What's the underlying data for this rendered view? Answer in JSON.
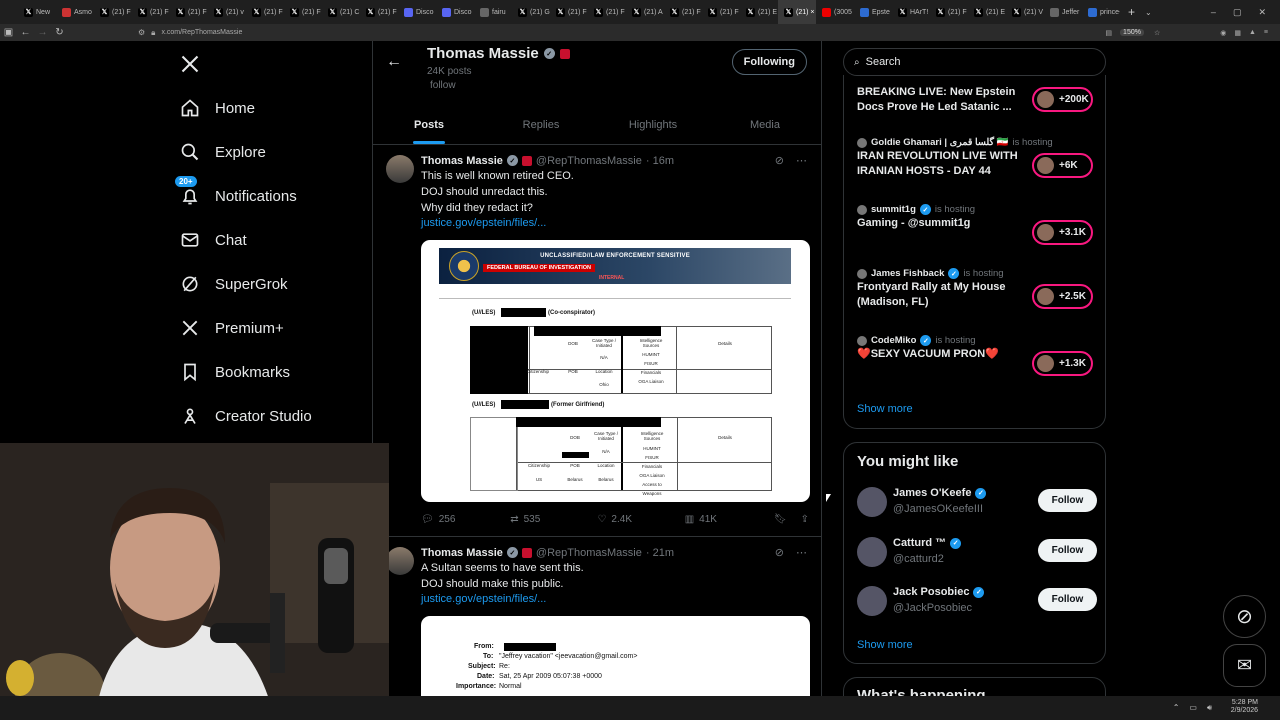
{
  "browser": {
    "tabs": [
      {
        "label": "New",
        "icon": "x-icon"
      },
      {
        "label": "Asmo",
        "icon": "asmon-icon"
      },
      {
        "label": "(21) F",
        "icon": "x-icon"
      },
      {
        "label": "(21) F",
        "icon": "x-icon"
      },
      {
        "label": "(21) F",
        "icon": "x-icon"
      },
      {
        "label": "(21) v",
        "icon": "x-icon"
      },
      {
        "label": "(21) F",
        "icon": "x-icon"
      },
      {
        "label": "(21) F",
        "icon": "x-icon"
      },
      {
        "label": "(21) C",
        "icon": "x-icon"
      },
      {
        "label": "(21) F",
        "icon": "x-icon"
      },
      {
        "label": "Disco",
        "icon": "discord-icon"
      },
      {
        "label": "Disco",
        "icon": "discord-icon"
      },
      {
        "label": "fairu",
        "icon": "globe-icon"
      },
      {
        "label": "(21) G",
        "icon": "x-icon"
      },
      {
        "label": "(21) F",
        "icon": "x-icon"
      },
      {
        "label": "(21) F",
        "icon": "x-icon"
      },
      {
        "label": "(21) A",
        "icon": "x-icon"
      },
      {
        "label": "(21) F",
        "icon": "x-icon"
      },
      {
        "label": "(21) F",
        "icon": "x-icon"
      },
      {
        "label": "(21) E",
        "icon": "x-icon"
      },
      {
        "label": "(21) ×",
        "icon": "x-icon",
        "active": true
      },
      {
        "label": "(3005",
        "icon": "youtube-icon"
      },
      {
        "label": "Epste",
        "icon": "doc-icon"
      },
      {
        "label": "HArT!",
        "icon": "x-icon"
      },
      {
        "label": "(21) F",
        "icon": "x-icon"
      },
      {
        "label": "(21) E",
        "icon": "x-icon"
      },
      {
        "label": "(21) V",
        "icon": "x-icon"
      },
      {
        "label": "Jeffer",
        "icon": "globe-icon"
      },
      {
        "label": "prince-an",
        "icon": "doc-icon"
      }
    ],
    "url": "x.com/RepThomasMassie",
    "zoom": "150%"
  },
  "nav": {
    "items": [
      {
        "label": "Home",
        "icon": "home-icon"
      },
      {
        "label": "Explore",
        "icon": "search-icon"
      },
      {
        "label": "Notifications",
        "icon": "bell-icon",
        "badge": "20+"
      },
      {
        "label": "Chat",
        "icon": "mail-icon"
      },
      {
        "label": "SuperGrok",
        "icon": "grok-icon"
      },
      {
        "label": "Premium+",
        "icon": "x-logo-icon"
      },
      {
        "label": "Bookmarks",
        "icon": "bookmark-icon"
      },
      {
        "label": "Creator Studio",
        "icon": "creator-icon"
      }
    ]
  },
  "profile": {
    "name": "Thomas Massie",
    "posts_count": "24K posts",
    "follow_partial": "follow",
    "following_label": "Following"
  },
  "profile_tabs": [
    "Posts",
    "Replies",
    "Highlights",
    "Media"
  ],
  "tweets": [
    {
      "name": "Thomas Massie",
      "handle": "@RepThomasMassie",
      "time": "· 16m",
      "lines": [
        "This is well known retired CEO.",
        "DOJ should unredact this.",
        "Why did they redact it?"
      ],
      "link": "justice.gov/epstein/files/...",
      "replies": "256",
      "reposts": "535",
      "likes": "2.4K",
      "views": "41K",
      "doc": {
        "classification": "UNCLASSIFIED//LAW ENFORCEMENT SENSITIVE",
        "agency": "FEDERAL BUREAU OF INVESTIGATION",
        "internal": "INTERNAL",
        "section1": "(U//LES)",
        "section1_role": "(Co-conspirator)",
        "section2": "(U//LES)",
        "section2_role": "(Former Girlfriend)",
        "cols": [
          "DOB",
          "Case Type / Initiated",
          "Intelligence Sources",
          "Details"
        ],
        "row_labels": [
          "Citizenship",
          "POB",
          "Location"
        ],
        "na": "N/A",
        "ohio": "Ohio",
        "us": "US",
        "belarus1": "Belarus",
        "belarus2": "Belarus",
        "sources": [
          "HUMINT",
          "FISUR",
          "Financials",
          "OGA Liaison",
          "Access to Weapons"
        ]
      }
    },
    {
      "name": "Thomas Massie",
      "handle": "@RepThomasMassie",
      "time": "· 21m",
      "lines": [
        "A Sultan seems to have sent this.",
        "DOJ should make this public."
      ],
      "link": "justice.gov/epstein/files/...",
      "email": {
        "from_label": "From:",
        "to_label": "To:",
        "to_value": "\"Jeffrey vacation\" <jeevacation@gmail.com>",
        "subject_label": "Subject:",
        "subject_value": "Re:",
        "date_label": "Date:",
        "date_value": "Sat, 25 Apr 2009 05:07:38 +0000",
        "importance_label": "Importance:",
        "importance_value": "Normal"
      }
    }
  ],
  "search": {
    "placeholder": "Search"
  },
  "spaces": [
    {
      "host": "",
      "hosting": "",
      "title": "BREAKING LIVE: New Epstein Docs Prove He Led Satanic ...",
      "count": "+200K"
    },
    {
      "host": "Goldie Ghamari | گلسا قمری 🇮🇷",
      "hosting": "is hosting",
      "title": "IRAN REVOLUTION LIVE WITH IRANIAN HOSTS - DAY 44",
      "count": "+6K"
    },
    {
      "host": "summit1g",
      "hosting": "is hosting",
      "title": "Gaming - @summit1g",
      "count": "+3.1K"
    },
    {
      "host": "James Fishback",
      "hosting": "is hosting",
      "title": "Frontyard Rally at My House (Madison, FL)",
      "count": "+2.5K"
    },
    {
      "host": "CodeMiko",
      "hosting": "is hosting",
      "title": "❤️SEXY VACUUM PRON❤️",
      "count": "+1.3K"
    }
  ],
  "spaces_show_more": "Show more",
  "who_to_follow": {
    "title": "You might like",
    "people": [
      {
        "name": "James O'Keefe",
        "handle": "@JamesOKeefeIII",
        "button": "Follow"
      },
      {
        "name": "Catturd ™",
        "handle": "@catturd2",
        "button": "Follow"
      },
      {
        "name": "Jack Posobiec",
        "handle": "@JackPosobiec",
        "button": "Follow"
      }
    ],
    "show_more": "Show more"
  },
  "happening": {
    "title": "What's happening"
  },
  "taskbar": {
    "time": "5:28 PM",
    "date": "2/9/2026"
  },
  "colors": {
    "accent": "#1d9bf0",
    "live_pink": "#f91880",
    "background": "#000000"
  }
}
